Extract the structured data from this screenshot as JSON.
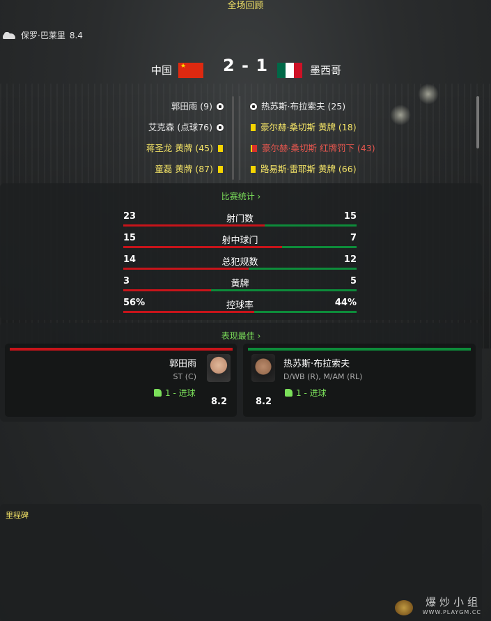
{
  "header": {
    "title": "全场回顾"
  },
  "player_of_match": {
    "name": "保罗·巴莱里",
    "rating": "8.4",
    "icon": "boot-icon"
  },
  "scoreline": {
    "home_team": "中国",
    "away_team": "墨西哥",
    "score": "2 - 1",
    "home_flag_icon": "china-flag-icon",
    "away_flag_icon": "mexico-flag-icon"
  },
  "events": {
    "home": [
      {
        "text": "郭田雨 (9)",
        "icon": "ball-icon",
        "color": "white"
      },
      {
        "text": "艾克森 (点球76)",
        "icon": "ball-icon",
        "color": "white"
      },
      {
        "text": "蒋圣龙 黄牌 (45)",
        "icon": "yellow-card-icon",
        "color": "yellow"
      },
      {
        "text": "童磊 黄牌 (87)",
        "icon": "yellow-card-icon",
        "color": "yellow"
      }
    ],
    "away": [
      {
        "text": "热苏斯·布拉索夫 (25)",
        "icon": "ball-icon",
        "color": "white"
      },
      {
        "text": "豪尔赫·桑切斯 黄牌 (18)",
        "icon": "yellow-card-icon",
        "color": "yellow"
      },
      {
        "text": "豪尔赫·桑切斯 红牌罚下 (43)",
        "icon": "red-card-icon",
        "color": "red"
      },
      {
        "text": "路易斯·雷耶斯 黄牌 (66)",
        "icon": "yellow-card-icon",
        "color": "yellow"
      }
    ]
  },
  "stats": {
    "link_label": "比赛统计 ›",
    "rows": [
      {
        "label": "射门数",
        "home": "23",
        "away": "15",
        "home_share": 0.605
      },
      {
        "label": "射中球门",
        "home": "15",
        "away": "7",
        "home_share": 0.68
      },
      {
        "label": "总犯规数",
        "home": "14",
        "away": "12",
        "home_share": 0.538
      },
      {
        "label": "黄牌",
        "home": "3",
        "away": "5",
        "home_share": 0.375
      },
      {
        "label": "控球率",
        "home": "56%",
        "away": "44%",
        "home_share": 0.56
      }
    ]
  },
  "best_players": {
    "link_label": "表现最佳 ›",
    "home": {
      "name": "郭田雨",
      "position": "ST (C)",
      "goals": "1 - 进球",
      "rating": "8.2"
    },
    "away": {
      "name": "热苏斯·布拉索夫",
      "position": "D/WB (R), M/AM (RL)",
      "goals": "1 - 进球",
      "rating": "8.2"
    }
  },
  "milestones": {
    "title": "里程碑"
  },
  "watermark": {
    "text": "爆炒小组",
    "url": "WWW.PLAYGM.CC"
  },
  "colors": {
    "home": "#c8141a",
    "away": "#0d8c3a",
    "accent_green": "#7be05a",
    "accent_yellow": "#f2e266"
  }
}
